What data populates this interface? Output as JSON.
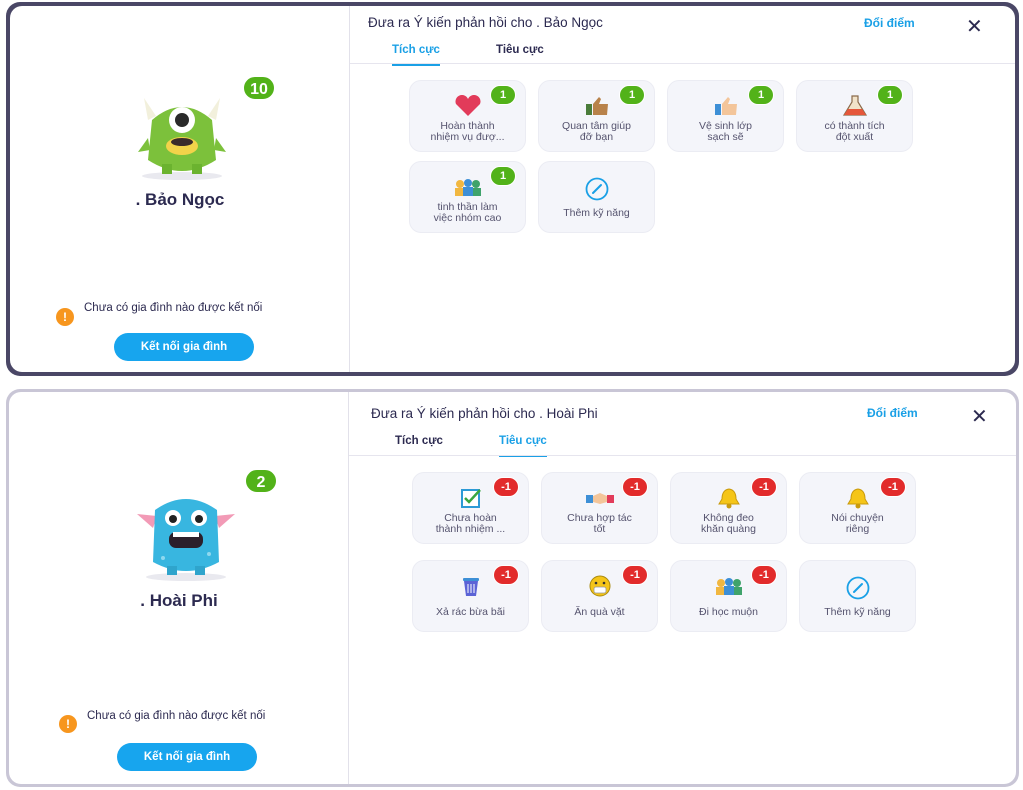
{
  "panel1": {
    "student_name": ". Bảo Ngọc",
    "points": "10",
    "family_warning": "Chưa có gia đình nào được kết nối",
    "connect_button": "Kết nối gia đình",
    "dialog_title": "Đưa ra Ý kiến phản hồi cho . Bảo Ngọc",
    "swap_points": "Đổi điểm",
    "close_icon": "✕",
    "tabs": [
      {
        "label": "Tích cực",
        "active": true
      },
      {
        "label": "Tiêu cực",
        "active": false
      }
    ],
    "skills": [
      {
        "line1": "Hoàn thành",
        "line2": "nhiệm vụ đượ...",
        "score": "1",
        "icon": "heart-icon"
      },
      {
        "line1": "Quan tâm giúp",
        "line2": "đỡ bạn",
        "score": "1",
        "icon": "thumbs-up-icon"
      },
      {
        "line1": "Vệ sinh lớp",
        "line2": "sạch sẽ",
        "score": "1",
        "icon": "thumbs-up-icon"
      },
      {
        "line1": "có thành tích",
        "line2": "đột xuất",
        "score": "1",
        "icon": "flask-icon"
      },
      {
        "line1": "tinh thần làm",
        "line2": "việc nhóm cao",
        "score": "1",
        "icon": "team-icon"
      },
      {
        "line1": "Thêm kỹ năng",
        "line2": "",
        "score": "",
        "icon": "add-skill-icon"
      }
    ]
  },
  "panel2": {
    "student_name": ". Hoài Phi",
    "points": "2",
    "family_warning": "Chưa có gia đình nào được kết nối",
    "connect_button": "Kết nối gia đình",
    "dialog_title": "Đưa ra Ý kiến phản hồi cho . Hoài Phi",
    "swap_points": "Đổi điểm",
    "close_icon": "✕",
    "tabs": [
      {
        "label": "Tích cực",
        "active": false
      },
      {
        "label": "Tiêu cực",
        "active": true
      }
    ],
    "skills": [
      {
        "line1": "Chưa hoàn",
        "line2": "thành nhiệm ...",
        "score": "-1",
        "icon": "checkbox-icon"
      },
      {
        "line1": "Chưa hợp tác",
        "line2": "tốt",
        "score": "-1",
        "icon": "handshake-icon"
      },
      {
        "line1": "Không đeo",
        "line2": "khăn quàng",
        "score": "-1",
        "icon": "bell-icon"
      },
      {
        "line1": "Nói chuyện",
        "line2": "riêng",
        "score": "-1",
        "icon": "bell-icon"
      },
      {
        "line1": "Xả rác bừa bãi",
        "line2": "",
        "score": "-1",
        "icon": "trash-icon"
      },
      {
        "line1": "Ăn quà vặt",
        "line2": "",
        "score": "-1",
        "icon": "sick-face-icon"
      },
      {
        "line1": "Đi học muộn",
        "line2": "",
        "score": "-1",
        "icon": "team-icon"
      },
      {
        "line1": "Thêm kỹ năng",
        "line2": "",
        "score": "",
        "icon": "add-skill-icon"
      }
    ]
  },
  "colors": {
    "accent": "#1aa0e6",
    "positive": "#52b219",
    "negative": "#e22b2b",
    "warning": "#f7961e"
  }
}
